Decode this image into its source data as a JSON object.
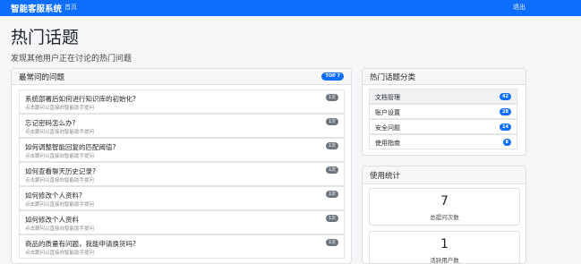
{
  "navbar": {
    "brand": "智能客服系统",
    "home_label": "首页",
    "logout_label": "退出"
  },
  "page": {
    "title": "热门话题",
    "subtitle": "发现其他用户正在讨论的热门问题"
  },
  "faq": {
    "header": "最常问的问题",
    "badge": "TOP 7",
    "items": [
      {
        "title": "系统部署后如何进行知识库的初始化?",
        "sub": "点击跟问以直接向智能助手提问",
        "count": "1次"
      },
      {
        "title": "忘记密码怎么办?",
        "sub": "点击跟问以直接向智能助手提问",
        "count": "1次"
      },
      {
        "title": "如何调整智能回复的匹配阈值?",
        "sub": "点击跟问以直接向智能助手提问",
        "count": "1次"
      },
      {
        "title": "如何查看聊天历史记录?",
        "sub": "点击跟问以直接向智能助手提问",
        "count": "1次"
      },
      {
        "title": "如何修改个人资料?",
        "sub": "点击跟问以直接向智能助手提问",
        "count": "1次"
      },
      {
        "title": "如何修改个人资料",
        "sub": "点击跟问以直接向智能助手提问",
        "count": "1次"
      },
      {
        "title": "商品的质量有问题，我能申请换货吗?",
        "sub": "点击跟问以直接向智能助手提问",
        "count": "1次"
      }
    ]
  },
  "categories": {
    "header": "热门话题分类",
    "items": [
      {
        "label": "文档管理",
        "count": "42"
      },
      {
        "label": "账户设置",
        "count": "28"
      },
      {
        "label": "安全问题",
        "count": "14"
      },
      {
        "label": "使用指南",
        "count": "8"
      }
    ]
  },
  "stats": {
    "header": "使用统计",
    "items": [
      {
        "value": "7",
        "label": "总提问次数"
      },
      {
        "value": "1",
        "label": "活跃用户数"
      }
    ]
  },
  "colors": {
    "primary": "#0d6efd",
    "secondary": "#6c757d",
    "background": "#f5f6f8"
  }
}
